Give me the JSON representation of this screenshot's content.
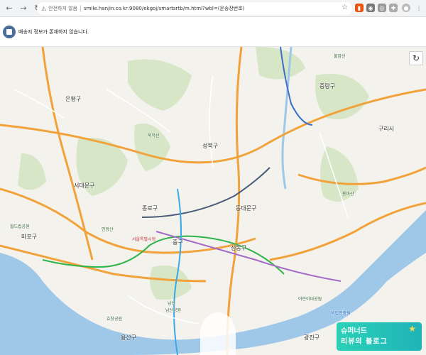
{
  "browser": {
    "security_label": "안전하지 않음",
    "url": "smile.hanjin.co.kr:9080/ekgoj/smartsrtb/m.html?wbl=(운송장번호)"
  },
  "notice": {
    "text": "배송지 정보가 존재하지 않습니다."
  },
  "map": {
    "districts": [
      {
        "name": "은평구"
      },
      {
        "name": "성북구"
      },
      {
        "name": "서대문구"
      },
      {
        "name": "종로구"
      },
      {
        "name": "동대문구"
      },
      {
        "name": "중랑구"
      },
      {
        "name": "마포구"
      },
      {
        "name": "중구"
      },
      {
        "name": "성동구"
      },
      {
        "name": "광진구"
      },
      {
        "name": "용산구"
      },
      {
        "name": "구리시"
      }
    ],
    "landmarks": [
      {
        "name": "서울특별시청"
      },
      {
        "name": "불암산"
      },
      {
        "name": "용마산"
      },
      {
        "name": "인왕산"
      },
      {
        "name": "북악산"
      },
      {
        "name": "남산"
      },
      {
        "name": "남산공원"
      },
      {
        "name": "효창공원"
      },
      {
        "name": "국립현충원"
      },
      {
        "name": "어린이대공원"
      },
      {
        "name": "월드컵공원"
      }
    ]
  },
  "watermark": {
    "line1": "슈퍼너드",
    "line2": "리뷰의 블로그"
  },
  "colors": {
    "water": "#9fc7e8",
    "park": "#cfe3bf",
    "road_major": "#f2a23a",
    "road_minor": "#ffffff"
  }
}
